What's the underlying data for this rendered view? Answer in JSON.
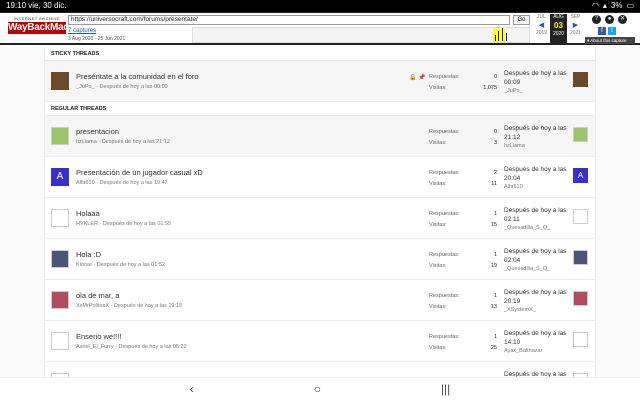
{
  "status": {
    "time": "19:10",
    "date": "vie, 30 dic.",
    "battery": "3%"
  },
  "wayback": {
    "logo_top": "INTERNET ARCHIVE",
    "logo_main": "WayBackMachine",
    "url": "https://universocraft.com/forums/presentate/",
    "go_label": "Go",
    "captures": "7 captures",
    "range": "3 Aug 2020 - 25 Jun 2021",
    "months": [
      {
        "month": "JUL",
        "day": "",
        "year": "2019",
        "arrow": "◀"
      },
      {
        "month": "AUG",
        "day": "03",
        "year": "2020",
        "arrow": ""
      },
      {
        "month": "SEP",
        "day": "",
        "year": "2021",
        "arrow": "▶"
      }
    ],
    "about": "▾ About this capture"
  },
  "sections": {
    "sticky": "STICKY THREADS",
    "regular": "REGULAR THREADS"
  },
  "labels": {
    "replies": "Respuestas:",
    "views": "Visitas:"
  },
  "sticky_threads": [
    {
      "title": "Preséntate a la comunidad en el foro",
      "author": "_JuPo_",
      "date": "Después de hoy a las 00:09",
      "replies": "0",
      "views": "1.075",
      "last_date": "Después de hoy a las 00:09",
      "last_user": "_JuPo_",
      "avatar_letter": "",
      "avatar_color": "#6b4a2b"
    }
  ],
  "threads": [
    {
      "title": "presentacion",
      "author": "ItzLlama",
      "date": "Después de hoy a las 21:12",
      "replies": "0",
      "views": "3",
      "last_date": "Después de hoy a las 21:12",
      "last_user": "ItzLlama",
      "avatar_letter": "",
      "avatar_color": "#9bc56a"
    },
    {
      "title": "Presentación de un jugador casual xD",
      "author": "Alfa610",
      "date": "Después de hoy a las 19:47",
      "replies": "2",
      "views": "11",
      "last_date": "Después de hoy a las 20:04",
      "last_user": "Alfa610",
      "avatar_letter": "A",
      "avatar_color": "#3a2fc9"
    },
    {
      "title": "Holaaa",
      "author": "HVKLER",
      "date": "Después de hoy a las 01:55",
      "replies": "1",
      "views": "15",
      "last_date": "Después de hoy a las 02:11",
      "last_user": "_Quesadilla_S_Q_",
      "avatar_letter": "",
      "avatar_color": "#ffffff"
    },
    {
      "title": "Hola :D",
      "author": "Ktorse",
      "date": "Después de hoy a las 01:52",
      "replies": "1",
      "views": "19",
      "last_date": "Después de hoy a las 02:04",
      "last_user": "_Quesadilla_S_Q_",
      "avatar_letter": "",
      "avatar_color": "#4a5577"
    },
    {
      "title": "ola de mar, a",
      "author": "XxMrPolitoxX",
      "date": "Después de hoy a las 19:10",
      "replies": "1",
      "views": "13",
      "last_date": "Después de hoy a las 20:19",
      "last_user": "_XSystemX_",
      "avatar_letter": "",
      "avatar_color": "#b44a5e"
    },
    {
      "title": "Enserio we!!!!",
      "author": "Asriel_El_Furry",
      "date": "Después de hoy a las 05:22",
      "replies": "1",
      "views": "25",
      "last_date": "Después de hoy a las 14:10",
      "last_user": "Ayax_Balthazar",
      "avatar_letter": "",
      "avatar_color": "#ffffff"
    },
    {
      "title": "",
      "author": "",
      "date": "",
      "replies": "",
      "views": "",
      "last_date": "Después de hoy a las",
      "last_user": "",
      "avatar_letter": "",
      "avatar_color": "#ffffff"
    }
  ],
  "nav": {
    "back": "‹",
    "home": "○",
    "recents": "|||"
  }
}
